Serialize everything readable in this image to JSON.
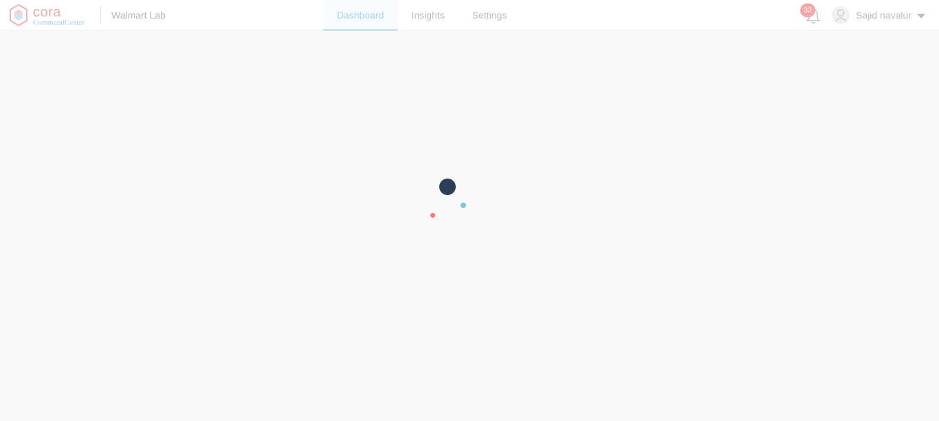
{
  "header": {
    "logo": {
      "name": "cora",
      "subtitle": "CommandCenter"
    },
    "org_name": "Walmart Lab",
    "tabs": [
      {
        "label": "Dashboard",
        "active": true
      },
      {
        "label": "Insights",
        "active": false
      },
      {
        "label": "Settings",
        "active": false
      }
    ],
    "notifications": {
      "count": "32",
      "icon": "bell-icon"
    },
    "user": {
      "name": "Sajid navalur",
      "avatar_icon": "user-icon",
      "menu_icon": "caret-down-icon"
    }
  },
  "loader": {
    "state": "loading",
    "colors": {
      "main": "#2c3e57",
      "secondary": "#7fc4d6",
      "accent": "#f27a7a"
    }
  },
  "colors": {
    "header_bg": "#ffffff",
    "page_bg": "#f9f9f9",
    "active_tab": "#a9d4e8",
    "badge": "#f7a6a6"
  }
}
